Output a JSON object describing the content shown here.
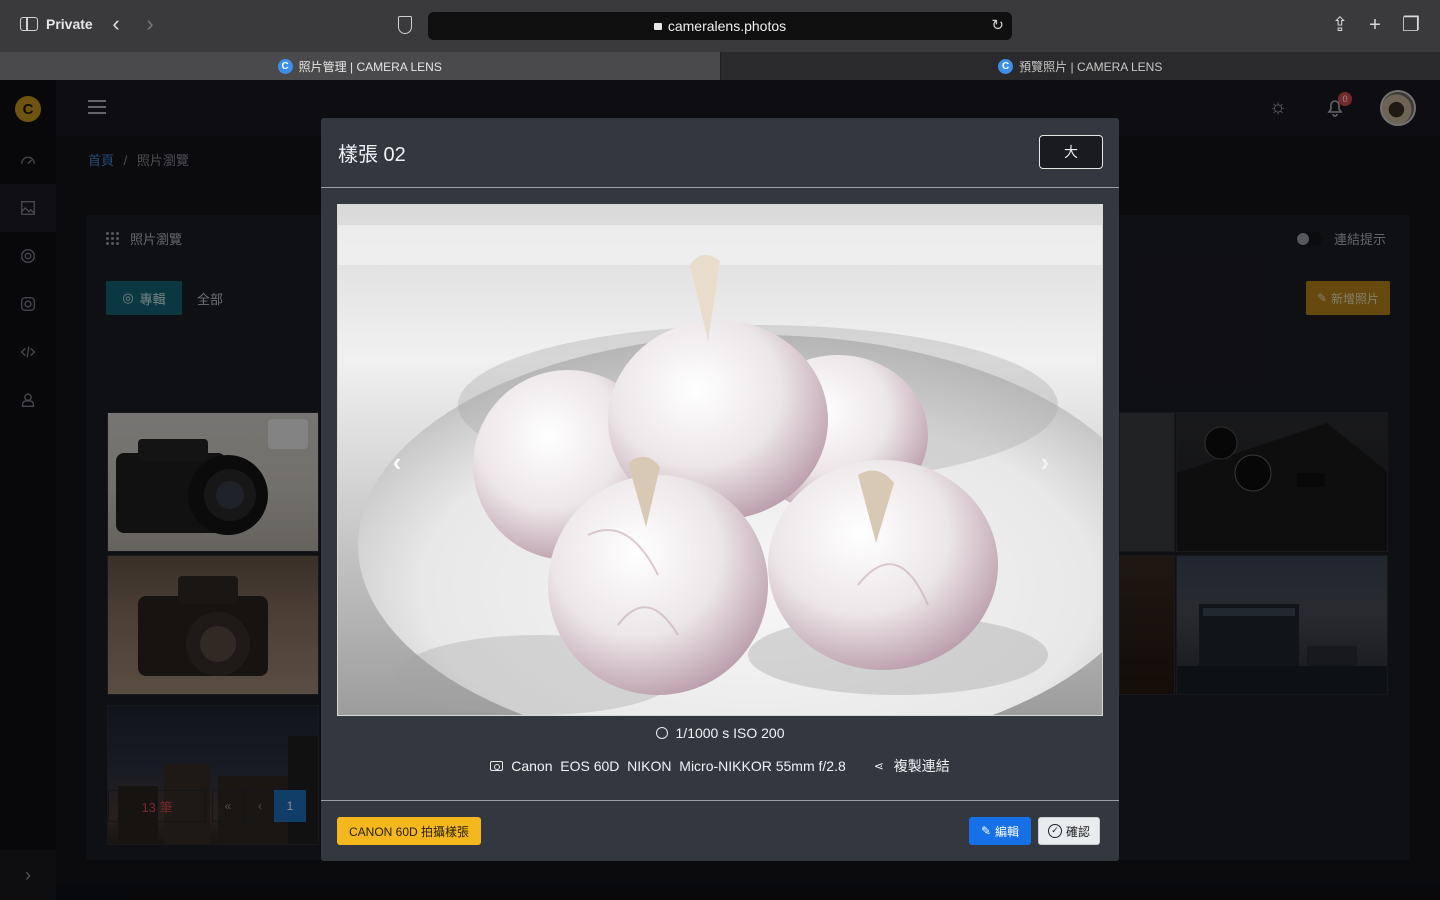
{
  "browser": {
    "private_label": "Private",
    "url": "cameralens.photos",
    "tabs": [
      {
        "favicon": "C",
        "title": "照片管理 | CAMERA LENS"
      },
      {
        "favicon": "C",
        "title": "預覽照片 | CAMERA LENS"
      }
    ]
  },
  "app": {
    "logo": "C",
    "notification_count": "0",
    "breadcrumb": {
      "home": "首頁",
      "separator": "/",
      "current": "照片瀏覽"
    },
    "card": {
      "title": "照片瀏覽",
      "link_hint": "連結提示",
      "segment": {
        "album": "專輯",
        "all": "全部"
      },
      "add_photo": "新增照片",
      "count": "13 筆",
      "pager": {
        "first": "«",
        "prev": "‹",
        "page": "1"
      }
    },
    "sidebar_icons": [
      "dashboard-icon",
      "image-icon",
      "lens-icon",
      "instagram-icon",
      "code-icon",
      "user-icon"
    ]
  },
  "modal": {
    "title": "樣張 02",
    "size_button": "大",
    "exif": "1/1000 s ISO 200",
    "camera": "Canon  EOS 60D  NIKON  Micro-NIKKOR 55mm f/2.8",
    "copy_link": "複製連結",
    "tag_button": "CANON 60D 拍攝樣張",
    "edit_button": "編輯",
    "confirm_button": "確認"
  },
  "colors": {
    "accent_blue": "#1670e8",
    "accent_yellow": "#f4b81e",
    "teal": "#156775",
    "danger": "#d14b4b"
  }
}
